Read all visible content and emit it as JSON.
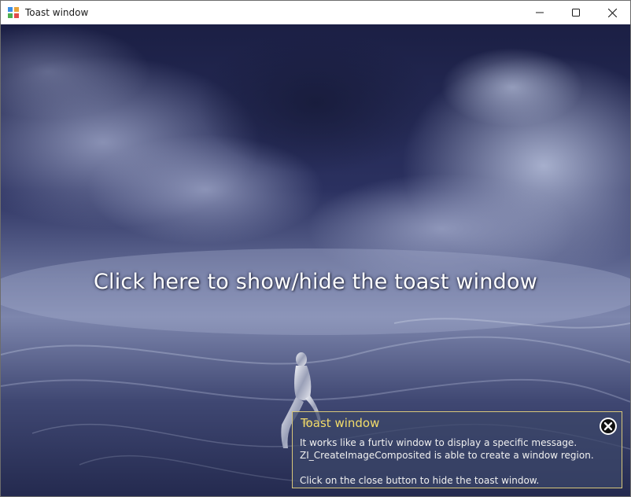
{
  "window": {
    "title": "Toast window",
    "controls": {
      "minimize_icon": "minimize-icon",
      "maximize_icon": "maximize-icon",
      "close_icon": "close-icon"
    }
  },
  "main": {
    "headline": "Click here to show/hide the toast window"
  },
  "toast": {
    "title": "Toast window",
    "lines": [
      "It works like a furtiv window to display a specific message.",
      "ZI_CreateImageComposited is able to create a window region.",
      "",
      "Click on the close button to hide the toast window."
    ],
    "close_icon": "circle-close-icon"
  },
  "colors": {
    "toast_border": "#d8c77a",
    "toast_title": "#f3dc6a",
    "toast_text": "#f0f0f0",
    "background_dark": "#1e2347",
    "background_light": "#8a93b8"
  }
}
